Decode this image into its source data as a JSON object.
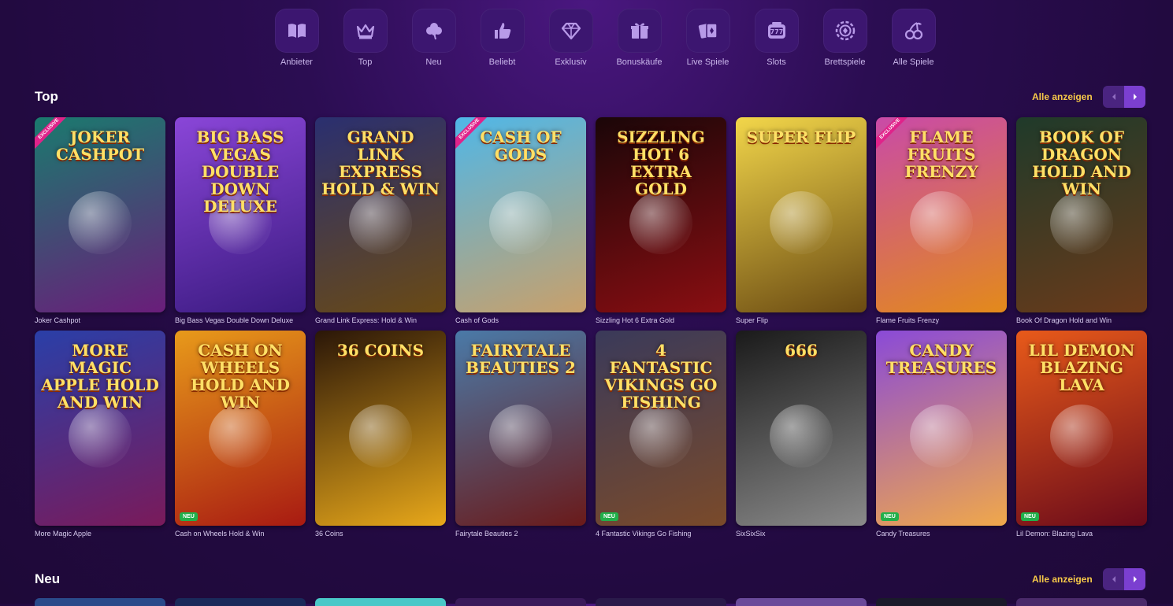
{
  "categories": [
    {
      "label": "Anbieter",
      "icon": "book-open-icon"
    },
    {
      "label": "Top",
      "icon": "crown-icon"
    },
    {
      "label": "Neu",
      "icon": "clover-icon"
    },
    {
      "label": "Beliebt",
      "icon": "thumbs-up-icon"
    },
    {
      "label": "Exklusiv",
      "icon": "diamond-icon"
    },
    {
      "label": "Bonuskäufe",
      "icon": "gift-icon"
    },
    {
      "label": "Live Spiele",
      "icon": "cards-icon"
    },
    {
      "label": "Slots",
      "icon": "slot-777-icon"
    },
    {
      "label": "Brettspiele",
      "icon": "chip-icon"
    },
    {
      "label": "Alle Spiele",
      "icon": "cherries-icon"
    }
  ],
  "sections": {
    "top": {
      "title": "Top",
      "see_all": "Alle anzeigen"
    },
    "neu": {
      "title": "Neu",
      "see_all": "Alle anzeigen"
    }
  },
  "top_games": [
    {
      "name": "Joker Cashpot",
      "logo": "JOKER CASHPOT",
      "ribbon": "EXCLUSIVE",
      "badge": "",
      "colors": [
        "#1a7a6e",
        "#6a1d7a"
      ]
    },
    {
      "name": "Big Bass Vegas Double Down Deluxe",
      "logo": "BIG BASS VEGAS DOUBLE DOWN DELUXE",
      "ribbon": "",
      "badge": "",
      "colors": [
        "#8a46d8",
        "#3a1a80"
      ]
    },
    {
      "name": "Grand Link Express: Hold & Win",
      "logo": "GRAND LINK EXPRESS HOLD & WIN",
      "ribbon": "",
      "badge": "",
      "colors": [
        "#2a2f70",
        "#6a4a14"
      ]
    },
    {
      "name": "Cash of Gods",
      "logo": "CASH OF GODS",
      "ribbon": "EXCLUSIVE",
      "badge": "",
      "colors": [
        "#4fb7e8",
        "#c9a06a"
      ]
    },
    {
      "name": "Sizzling Hot 6 Extra Gold",
      "logo": "SIZZLING HOT 6 extra gold",
      "ribbon": "",
      "badge": "",
      "colors": [
        "#1a0608",
        "#8a0e12"
      ]
    },
    {
      "name": "Super Flip",
      "logo": "SUPER FLIP",
      "ribbon": "",
      "badge": "",
      "colors": [
        "#f2d64a",
        "#6a4a12"
      ]
    },
    {
      "name": "Flame Fruits Frenzy",
      "logo": "FLAME FRUITS FRENZY",
      "ribbon": "EXCLUSIVE",
      "badge": "",
      "colors": [
        "#c94aa8",
        "#e38a1a"
      ]
    },
    {
      "name": "Book Of Dragon Hold and Win",
      "logo": "BOOK OF DRAGON HOLD AND WIN",
      "ribbon": "",
      "badge": "",
      "colors": [
        "#1f3a2a",
        "#6a3a1a"
      ]
    },
    {
      "name": "More Magic Apple",
      "logo": "MORE MAGIC APPLE HOLD AND WIN",
      "ribbon": "",
      "badge": "",
      "colors": [
        "#2a3fa8",
        "#7a1a5a"
      ]
    },
    {
      "name": "Cash on Wheels Hold & Win",
      "logo": "CASH ON WHEELS HOLD AND WIN",
      "ribbon": "",
      "badge": "NEU",
      "colors": [
        "#e89a1a",
        "#a81a12"
      ]
    },
    {
      "name": "36 Coins",
      "logo": "36 COINS",
      "ribbon": "",
      "badge": "",
      "colors": [
        "#2a1608",
        "#e8a81a"
      ]
    },
    {
      "name": "Fairytale Beauties 2",
      "logo": "FAIRYTALE BEAUTIES 2",
      "ribbon": "",
      "badge": "",
      "colors": [
        "#4a7aa8",
        "#6a1a1a"
      ]
    },
    {
      "name": "4 Fantastic Vikings Go Fishing",
      "logo": "4 FANTASTIC VIKINGS GO FISHING",
      "ribbon": "",
      "badge": "NEU",
      "colors": [
        "#3a3a5a",
        "#7a4a2a"
      ]
    },
    {
      "name": "SixSixSix",
      "logo": "666",
      "ribbon": "",
      "badge": "",
      "colors": [
        "#1a1a1a",
        "#8a8a8a"
      ]
    },
    {
      "name": "Candy Treasures",
      "logo": "CANDY TREASURES",
      "ribbon": "",
      "badge": "NEU",
      "colors": [
        "#8a4ad8",
        "#f0a84a"
      ]
    },
    {
      "name": "Lil Demon: Blazing Lava",
      "logo": "LIL DEMON BLAZING LAVA",
      "ribbon": "",
      "badge": "NEU",
      "colors": [
        "#e85a1a",
        "#6a0a1a"
      ]
    }
  ],
  "neu_peek_colors": [
    "#2a4a8a",
    "#1a2a5a",
    "#4ac8c8",
    "#3a1a5a",
    "#2a1a4a",
    "#6a4a9a",
    "#1a1a2a",
    "#4a2a6a"
  ],
  "colors": {
    "accent": "#f7c948",
    "pager_active": "#7b3fd0",
    "icon_fill": "#b89ae8"
  }
}
